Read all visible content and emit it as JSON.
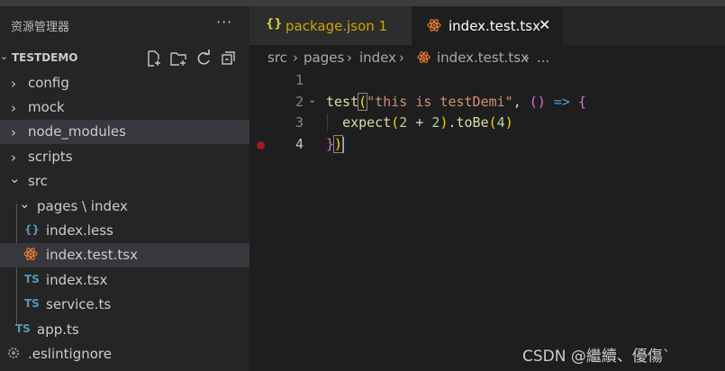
{
  "explorer": {
    "title": "资源管理器",
    "more": "···",
    "project": "TESTDEMO",
    "tree": [
      {
        "label": "config",
        "chevron": "›",
        "icon": ""
      },
      {
        "label": "mock",
        "chevron": "›",
        "icon": ""
      },
      {
        "label": "node_modules",
        "chevron": "›",
        "icon": ""
      },
      {
        "label": "scripts",
        "chevron": "›",
        "icon": ""
      },
      {
        "label": "src",
        "chevron": "⌄",
        "icon": ""
      },
      {
        "label": "pages \\ index",
        "chevron": "⌄",
        "icon": ""
      },
      {
        "label": "index.less",
        "chevron": "",
        "icon": "{}"
      },
      {
        "label": "index.test.tsx",
        "chevron": "",
        "icon": "react"
      },
      {
        "label": "index.tsx",
        "chevron": "",
        "icon": "TS"
      },
      {
        "label": "service.ts",
        "chevron": "",
        "icon": "TS"
      },
      {
        "label": "app.ts",
        "chevron": "",
        "icon": "TS"
      },
      {
        "label": ".eslintignore",
        "chevron": "",
        "icon": "gear"
      }
    ]
  },
  "tabs": [
    {
      "label": "package.json 1",
      "icon": "{}"
    },
    {
      "label": "index.test.tsx",
      "icon": "react",
      "close": "✕"
    }
  ],
  "breadcrumb": [
    "src",
    "›",
    "pages",
    "›",
    "index",
    "›",
    "index.test.tsx",
    "›",
    "..."
  ],
  "editor": {
    "line_numbers": [
      "1",
      "2",
      "3",
      "4"
    ],
    "lines": [
      "",
      "test(\"this is testDemi\", () => {",
      "  expect(2 + 2).toBe(4)",
      "})"
    ]
  },
  "watermark": "CSDN @繼續、優傷`",
  "colors": {
    "accent": "#519aba",
    "react": "#e37933",
    "ts": "#519aba",
    "json": "#cbcb41"
  }
}
